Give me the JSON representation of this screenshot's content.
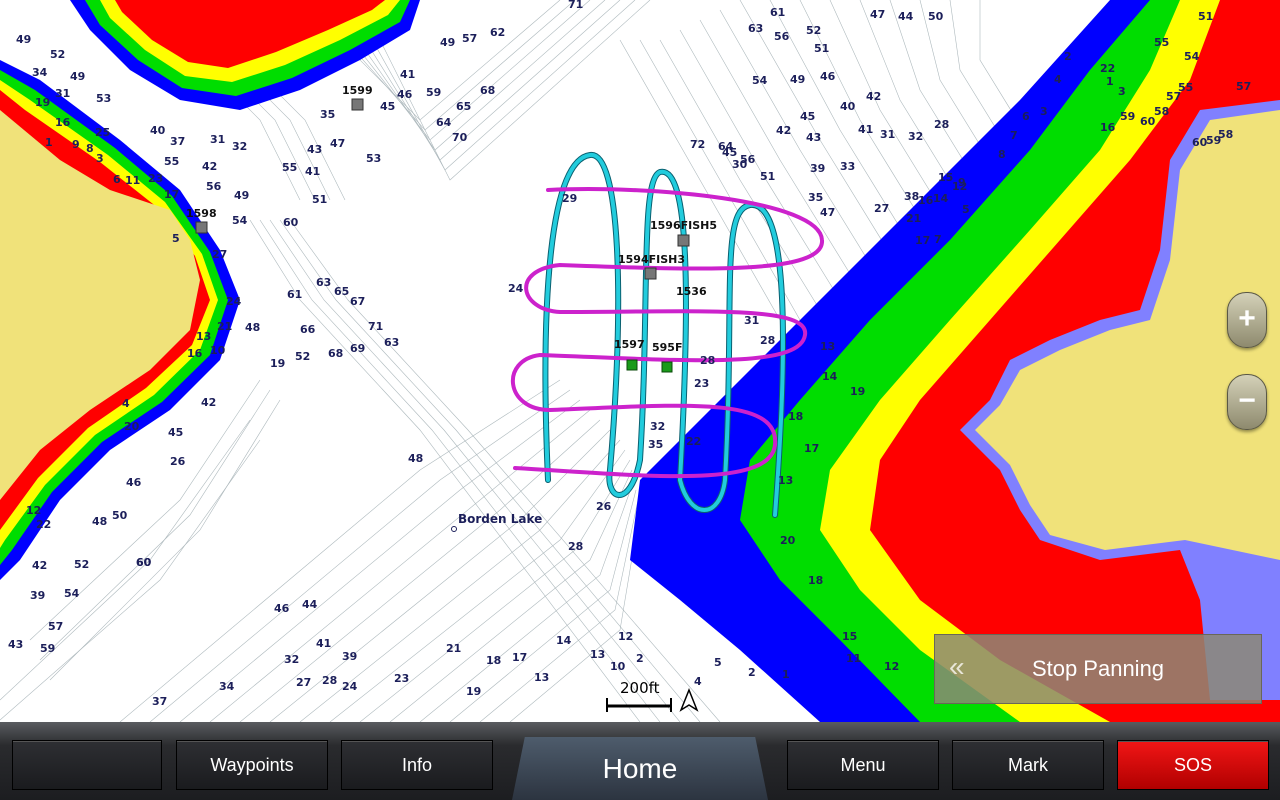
{
  "map": {
    "place_name": "Borden Lake",
    "scale_label": "200ft",
    "waypoints": [
      "1599",
      "1598",
      "1596FISH5",
      "1594FISH3",
      "1536",
      "1597",
      "595F"
    ],
    "depth_labels": [
      "49",
      "52",
      "34",
      "49",
      "31",
      "53",
      "19",
      "16",
      "25",
      "1",
      "9",
      "8",
      "3",
      "6",
      "11",
      "23",
      "17",
      "40",
      "37",
      "31",
      "32",
      "55",
      "42",
      "56",
      "49",
      "54",
      "5",
      "27",
      "24",
      "21",
      "13",
      "16",
      "48",
      "10",
      "4",
      "20",
      "45",
      "12",
      "26",
      "42",
      "22",
      "46",
      "48",
      "50",
      "60",
      "42",
      "52",
      "54",
      "39",
      "57",
      "43",
      "59",
      "60",
      "61",
      "63",
      "65",
      "67",
      "66",
      "68",
      "69",
      "71",
      "63",
      "19",
      "52",
      "60",
      "51",
      "55",
      "41",
      "43",
      "47",
      "35",
      "45",
      "46",
      "41",
      "59",
      "49",
      "57",
      "62",
      "64",
      "65",
      "68",
      "70",
      "53",
      "71",
      "63",
      "61",
      "56",
      "52",
      "51",
      "54",
      "49",
      "46",
      "45",
      "43",
      "40",
      "42",
      "41",
      "39",
      "33",
      "31",
      "32",
      "28",
      "27",
      "38",
      "35",
      "47",
      "45",
      "42",
      "56",
      "51",
      "47",
      "44",
      "50",
      "72",
      "64",
      "30",
      "29",
      "24",
      "28",
      "31",
      "28",
      "23",
      "32",
      "35",
      "22",
      "26",
      "28",
      "21",
      "17",
      "16",
      "14",
      "15",
      "12",
      "13",
      "14",
      "19",
      "18",
      "17",
      "13",
      "20",
      "18",
      "15",
      "11",
      "12",
      "7",
      "5",
      "9",
      "8",
      "7",
      "6",
      "3",
      "4",
      "2",
      "22",
      "1",
      "3",
      "16",
      "59",
      "60",
      "58",
      "57",
      "55",
      "60",
      "59",
      "58",
      "57",
      "55",
      "54",
      "51",
      "48",
      "46",
      "44",
      "41",
      "39",
      "37",
      "34",
      "32",
      "27",
      "28",
      "24",
      "23",
      "21",
      "19",
      "18",
      "17",
      "13",
      "14",
      "13",
      "10",
      "12",
      "2",
      "4",
      "5",
      "2",
      "1"
    ]
  },
  "zoom": {
    "in_label": "+",
    "out_label": "−"
  },
  "stop_panning": {
    "label": "Stop Panning",
    "chevron": "«"
  },
  "bottombar": {
    "blank_label": "",
    "waypoints_label": "Waypoints",
    "info_label": "Info",
    "home_label": "Home",
    "menu_label": "Menu",
    "mark_label": "Mark",
    "sos_label": "SOS"
  },
  "colors": {
    "land": "#f0e27a",
    "deep_blue": "#0000ff",
    "green": "#00dd00",
    "yellow": "#ffff00",
    "red": "#ff0000",
    "lavender": "#8080ff",
    "track_cyan": "#22ccdd",
    "track_magenta": "#cc22cc",
    "sos": "#e00000"
  }
}
